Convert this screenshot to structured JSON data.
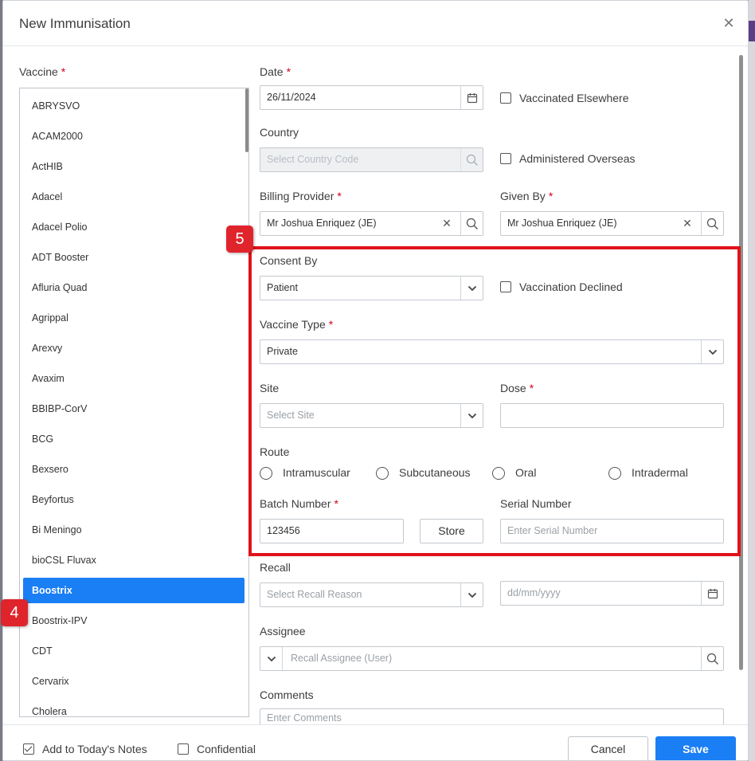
{
  "modal": {
    "title": "New Immunisation",
    "close_glyph": "✕"
  },
  "vaccine": {
    "label": "Vaccine",
    "required": "*",
    "items": [
      "ABRYSVO",
      "ACAM2000",
      "ActHIB",
      "Adacel",
      "Adacel Polio",
      "ADT Booster",
      "Afluria Quad",
      "Agrippal",
      "Arexvy",
      "Avaxim",
      "BBIBP-CorV",
      "BCG",
      "Bexsero",
      "Beyfortus",
      "Bi Meningo",
      "bioCSL Fluvax",
      "Boostrix",
      "Boostrix-IPV",
      "CDT",
      "Cervarix",
      "Cholera"
    ],
    "selected": "Boostrix"
  },
  "date": {
    "label": "Date",
    "required": "*",
    "value": "26/11/2024"
  },
  "vaccinated_elsewhere": {
    "label": "Vaccinated Elsewhere",
    "checked": false
  },
  "country": {
    "label": "Country",
    "placeholder": "Select Country Code"
  },
  "administered_overseas": {
    "label": "Administered Overseas",
    "checked": false
  },
  "billing_provider": {
    "label": "Billing Provider",
    "required": "*",
    "value": "Mr Joshua Enriquez (JE)"
  },
  "given_by": {
    "label": "Given By",
    "required": "*",
    "value": "Mr Joshua Enriquez (JE)"
  },
  "consent_by": {
    "label": "Consent By",
    "value": "Patient"
  },
  "vaccination_declined": {
    "label": "Vaccination Declined",
    "checked": false
  },
  "vaccine_type": {
    "label": "Vaccine Type",
    "required": "*",
    "value": "Private"
  },
  "site": {
    "label": "Site",
    "placeholder": "Select Site"
  },
  "dose": {
    "label": "Dose",
    "required": "*",
    "value": ""
  },
  "route": {
    "label": "Route",
    "options": [
      "Intramuscular",
      "Subcutaneous",
      "Oral",
      "Intradermal"
    ]
  },
  "batch_number": {
    "label": "Batch Number",
    "required": "*",
    "value": "123456",
    "store_label": "Store"
  },
  "serial_number": {
    "label": "Serial Number",
    "placeholder": "Enter Serial Number"
  },
  "recall": {
    "label": "Recall",
    "placeholder": "Select Recall Reason",
    "date_placeholder": "dd/mm/yyyy"
  },
  "assignee": {
    "label": "Assignee",
    "placeholder": "Recall Assignee (User)"
  },
  "comments": {
    "label": "Comments",
    "placeholder": "Enter Comments"
  },
  "footer": {
    "add_to_notes": {
      "label": "Add to Today's Notes",
      "checked": true
    },
    "confidential": {
      "label": "Confidential",
      "checked": false
    },
    "cancel_label": "Cancel",
    "save_label": "Save"
  },
  "annotations": {
    "step_5": "5",
    "step_4": "4"
  },
  "colors": {
    "primary": "#1a7ef5",
    "highlight": "#e0121b",
    "required": "#d0021b"
  },
  "icons": {
    "calendar": "calendar-icon",
    "search": "search-icon",
    "chevron": "chevron-down-icon",
    "clear": "clear-icon"
  }
}
